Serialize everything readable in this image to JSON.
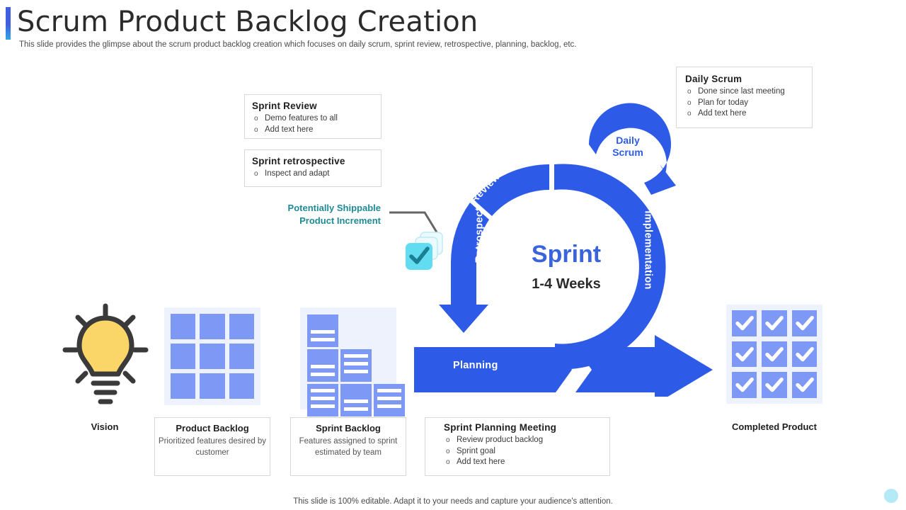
{
  "header": {
    "title": "Scrum Product Backlog Creation",
    "subtitle": "This slide provides the glimpse about the scrum product backlog creation which focuses on daily scrum, sprint review, retrospective, planning, backlog, etc.",
    "accent_color": "#3f5fe0"
  },
  "footer": {
    "note": "This slide is 100% editable. Adapt it to your needs and capture your audience's attention."
  },
  "colors": {
    "primary_blue": "#2d5be8",
    "light_blue": "#7e98f5",
    "panel_bg": "#eef2fd",
    "teal": "#1f8a96",
    "cyan": "#62dcf0",
    "bulb_yellow": "#f9d667"
  },
  "cards": {
    "sprint_review": {
      "title": "Sprint Review",
      "items": [
        "Demo features to all",
        "Add text here"
      ]
    },
    "sprint_retrospective": {
      "title": "Sprint retrospective",
      "items": [
        "Inspect and adapt"
      ]
    },
    "daily_scrum": {
      "title": "Daily  Scrum",
      "items": [
        "Done since last meeting",
        "Plan for today",
        "Add text here"
      ]
    },
    "sprint_planning_meeting": {
      "title": "Sprint Planning Meeting",
      "items": [
        "Review  product  backlog",
        "Sprint goal",
        "Add text here"
      ]
    }
  },
  "pipeline": {
    "vision": {
      "label": "Vision",
      "icon": "lightbulb-icon"
    },
    "product_backlog": {
      "title": "Product Backlog",
      "desc": "Prioritized features desired by customer",
      "icon": "grid-icon"
    },
    "sprint_backlog": {
      "title": "Sprint Backlog",
      "desc": "Features assigned to sprint estimated by team",
      "icon": "cards-icon"
    },
    "completed_product": {
      "label": "Completed Product",
      "icon": "check-grid-icon"
    }
  },
  "increment": {
    "label_line1": "Potentially Shippable",
    "label_line2": "Product Increment",
    "icon": "stacked-check-cards-icon"
  },
  "cycle": {
    "center_title": "Sprint",
    "center_subtitle": "1-4 Weeks",
    "daily_scrum": "Daily\nScrum",
    "daily_scrum_line1": "Daily",
    "daily_scrum_line2": "Scrum",
    "segments": {
      "review": "Review",
      "retrospect": "Retrospect",
      "implementation": "Implementation",
      "planning": "Planning"
    }
  }
}
